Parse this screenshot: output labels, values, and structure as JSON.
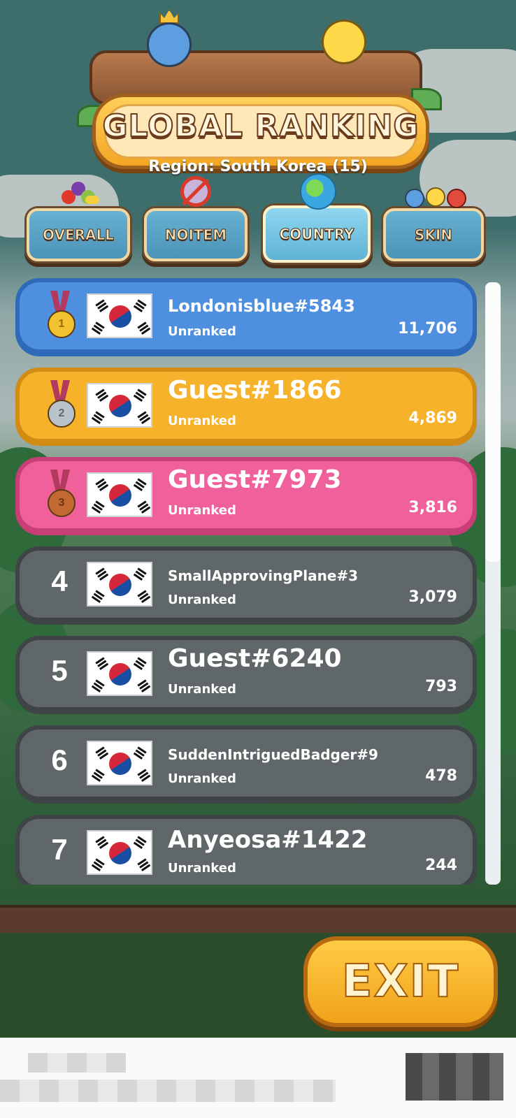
{
  "header": {
    "title": "GLOBAL RANKING",
    "region": "Region: South Korea (15)"
  },
  "tabs": [
    {
      "label": "OVERALL",
      "icon": "fruit-basket-icon",
      "active": false
    },
    {
      "label": "NOITEM",
      "icon": "no-items-icon",
      "active": false
    },
    {
      "label": "COUNTRY",
      "icon": "globe-icon",
      "active": true
    },
    {
      "label": "SKIN",
      "icon": "birds-skin-icon",
      "active": false
    }
  ],
  "leaderboard": [
    {
      "rank": "1",
      "medal": "gold-medal-icon",
      "flag": "south-korea-flag-icon",
      "name": "Londonisblue#5843",
      "status": "Unranked",
      "score": "11,706",
      "color": "#4f8fe0"
    },
    {
      "rank": "2",
      "medal": "silver-medal-icon",
      "flag": "south-korea-flag-icon",
      "name": "Guest#1866",
      "status": "Unranked",
      "score": "4,869",
      "color": "#f6b22a"
    },
    {
      "rank": "3",
      "medal": "bronze-medal-icon",
      "flag": "south-korea-flag-icon",
      "name": "Guest#7973",
      "status": "Unranked",
      "score": "3,816",
      "color": "#f0609a"
    },
    {
      "rank": "4",
      "flag": "south-korea-flag-icon",
      "name": "SmallApprovingPlane#3",
      "status": "Unranked",
      "score": "3,079",
      "color": "#5f6769"
    },
    {
      "rank": "5",
      "flag": "south-korea-flag-icon",
      "name": "Guest#6240",
      "status": "Unranked",
      "score": "793",
      "color": "#5f6769"
    },
    {
      "rank": "6",
      "flag": "south-korea-flag-icon",
      "name": "SuddenIntriguedBadger#9",
      "status": "Unranked",
      "score": "478",
      "color": "#5f6769"
    },
    {
      "rank": "7",
      "flag": "south-korea-flag-icon",
      "name": "Anyeosa#1422",
      "status": "Unranked",
      "score": "244",
      "color": "#5f6769"
    }
  ],
  "exit_label": "EXIT"
}
